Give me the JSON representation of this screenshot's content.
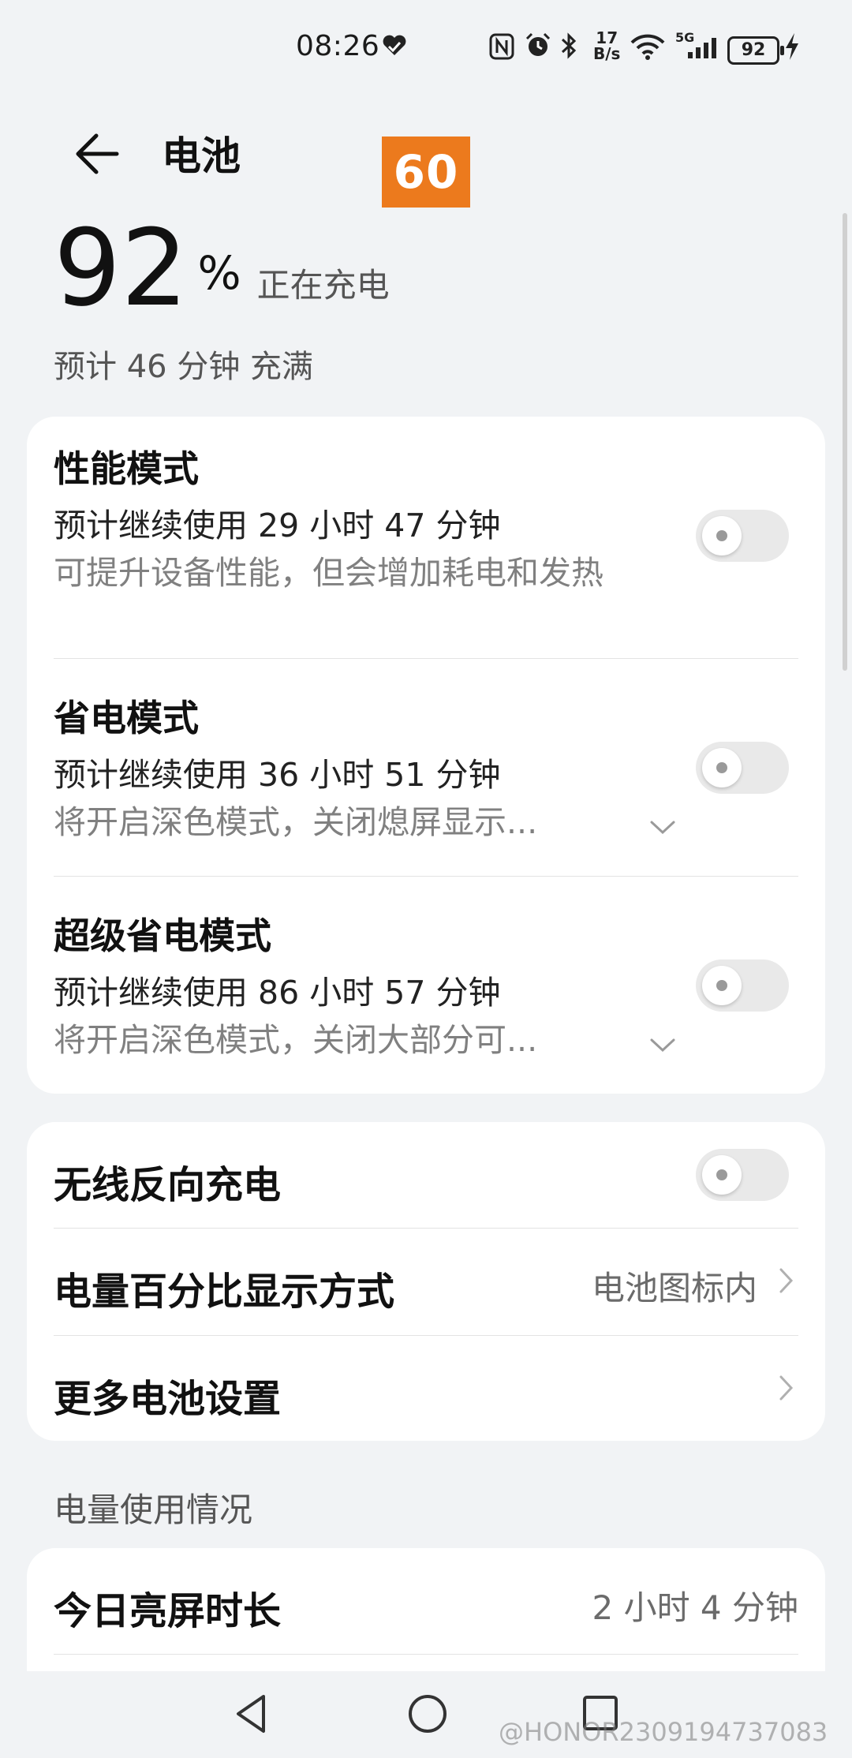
{
  "status_bar": {
    "time": "08:26",
    "net_speed": "17\nB/s",
    "network_type": "5G",
    "battery_level": "92",
    "icons": [
      "heart-shield-icon",
      "nfc-icon",
      "alarm-icon",
      "bluetooth-icon",
      "net-speed-icon",
      "wifi-icon",
      "signal-icon",
      "battery-icon",
      "charging-bolt-icon"
    ]
  },
  "overlay": {
    "fps": "60",
    "color": "#ec7a1d"
  },
  "header": {
    "title": "电池",
    "back_icon": "back-arrow-icon"
  },
  "battery": {
    "percent": "92",
    "percent_sign": "%",
    "charging_status": "正在充电",
    "estimate_full": "预计 46 分钟 充满"
  },
  "modes": [
    {
      "title": "性能模式",
      "estimate": "预计继续使用 29 小时 47 分钟",
      "desc": "可提升设备性能，但会增加耗电和发热",
      "toggle_on": false,
      "expandable": false
    },
    {
      "title": "省电模式",
      "estimate": "预计继续使用 36 小时 51 分钟",
      "desc": "将开启深色模式，关闭熄屏显示...",
      "toggle_on": false,
      "expandable": true
    },
    {
      "title": "超级省电模式",
      "estimate": "预计继续使用 86 小时 57 分钟",
      "desc": "将开启深色模式，关闭大部分可...",
      "toggle_on": false,
      "expandable": true
    }
  ],
  "settings": {
    "reverse_charging": {
      "title": "无线反向充电",
      "toggle_on": false
    },
    "percent_display": {
      "title": "电量百分比显示方式",
      "value": "电池图标内"
    },
    "more_settings": {
      "title": "更多电池设置"
    }
  },
  "usage": {
    "section_label": "电量使用情况",
    "screen_on_today": {
      "title": "今日亮屏时长",
      "value": "2 小时 4 分钟"
    }
  },
  "nav_bar": {
    "icons": [
      "back-triangle-icon",
      "home-circle-icon",
      "recents-square-icon"
    ]
  },
  "watermark": "@HONOR2309194737083",
  "colors": {
    "background": "#f1f3f5",
    "card": "#ffffff",
    "toggle_off": "#e9e9e9",
    "accent_badge": "#ec7a1d"
  }
}
